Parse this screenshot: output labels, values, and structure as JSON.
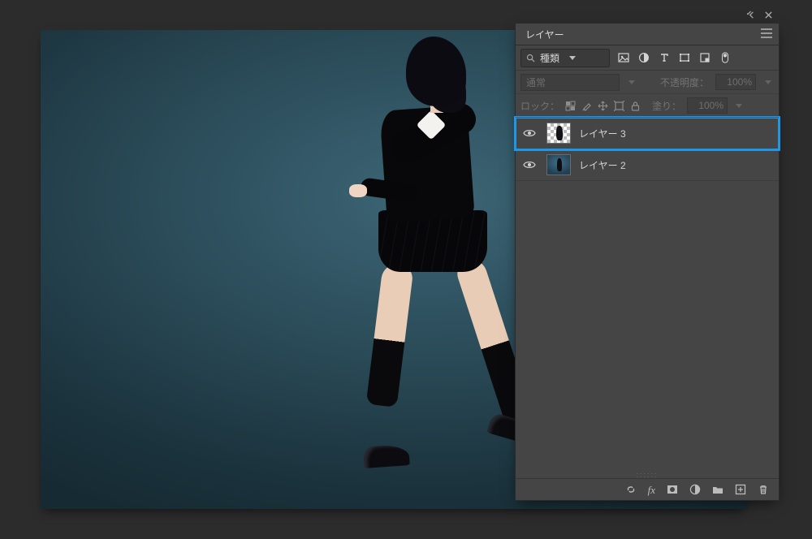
{
  "panel": {
    "title": "レイヤー",
    "filter_label": "種類",
    "blend_mode": "通常",
    "opacity_label": "不透明度：",
    "opacity_value": "100%",
    "lock_label": "ロック：",
    "fill_label": "塗り：",
    "fill_value": "100%"
  },
  "layers": [
    {
      "name": "レイヤー 3",
      "visible": true,
      "selected": true,
      "thumb": "checker"
    },
    {
      "name": "レイヤー 2",
      "visible": true,
      "selected": false,
      "thumb": "image"
    }
  ],
  "icons": {
    "collapse": "collapse-icon",
    "close": "close-icon",
    "menu": "menu-icon",
    "search": "search-icon",
    "chevron_down": "chevron-down-icon",
    "filter_image": "filter-image-icon",
    "filter_adjust": "filter-adjustment-icon",
    "filter_type": "filter-type-icon",
    "filter_shape": "filter-shape-icon",
    "filter_smart": "filter-smartobject-icon",
    "filter_toggle": "filter-toggle-icon",
    "lock_pixels": "lock-pixels-icon",
    "lock_brush": "lock-brush-icon",
    "lock_move": "lock-move-icon",
    "lock_artboard": "lock-artboard-icon",
    "lock_all": "lock-all-icon",
    "eye": "visibility-icon",
    "link": "link-layers-icon",
    "fx": "layer-effects-icon",
    "mask": "add-mask-icon",
    "adjustment": "new-adjustment-icon",
    "group": "new-group-icon",
    "new": "new-layer-icon",
    "trash": "delete-layer-icon"
  }
}
